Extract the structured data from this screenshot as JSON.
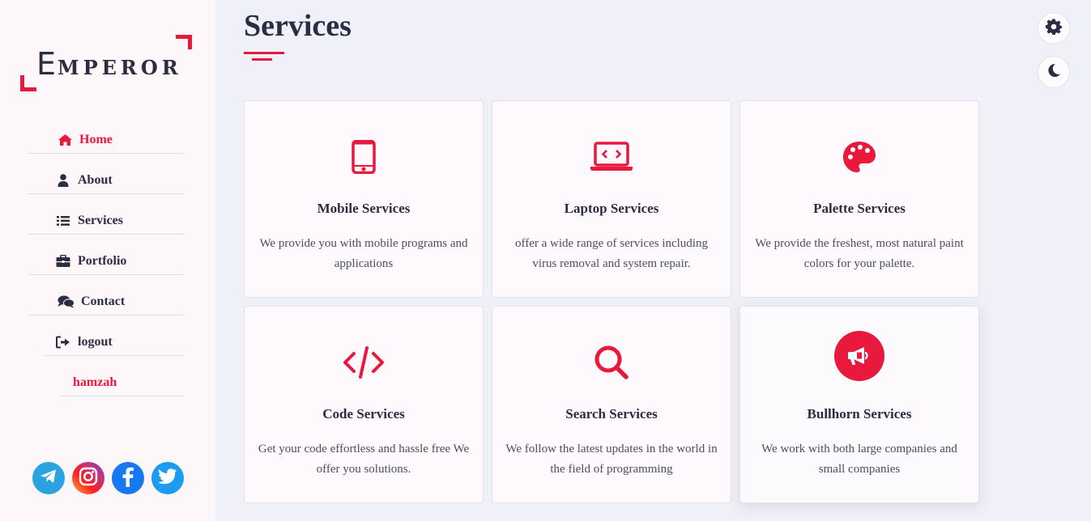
{
  "brand": {
    "first_letter": "E",
    "rest": "MPEROR"
  },
  "nav": {
    "items": [
      {
        "label": "Home",
        "icon": "home-icon",
        "active": true
      },
      {
        "label": "About",
        "icon": "user-icon",
        "active": false
      },
      {
        "label": "Services",
        "icon": "list-icon",
        "active": false
      },
      {
        "label": "Portfolio",
        "icon": "briefcase-icon",
        "active": false
      },
      {
        "label": "Contact",
        "icon": "comments-icon",
        "active": false
      },
      {
        "label": "logout",
        "icon": "sign-out-icon",
        "active": false
      }
    ],
    "username": "hamzah"
  },
  "socials": [
    "telegram-icon",
    "instagram-icon",
    "facebook-icon",
    "twitter-icon"
  ],
  "page": {
    "title": "Services"
  },
  "services": [
    {
      "icon": "mobile-icon",
      "title": "Mobile Services",
      "desc": "We provide you with mobile programs and applications"
    },
    {
      "icon": "laptop-code-icon",
      "title": "Laptop Services",
      "desc": "offer a wide range of services including virus removal and system repair."
    },
    {
      "icon": "palette-icon",
      "title": "Palette Services",
      "desc": "We provide the freshest, most natural paint colors for your palette."
    },
    {
      "icon": "code-icon",
      "title": "Code Services",
      "desc": "Get your code effortless and hassle free We offer you solutions."
    },
    {
      "icon": "search-icon",
      "title": "Search Services",
      "desc": "We follow the latest updates in the world in the field of programming"
    },
    {
      "icon": "bullhorn-icon",
      "title": "Bullhorn Services",
      "desc": "We work with both large companies and small companies"
    }
  ],
  "colors": {
    "accent": "#e8193c",
    "text": "#2b2d42",
    "background": "#f0f1f8",
    "sidebar": "#fdf7fa"
  }
}
